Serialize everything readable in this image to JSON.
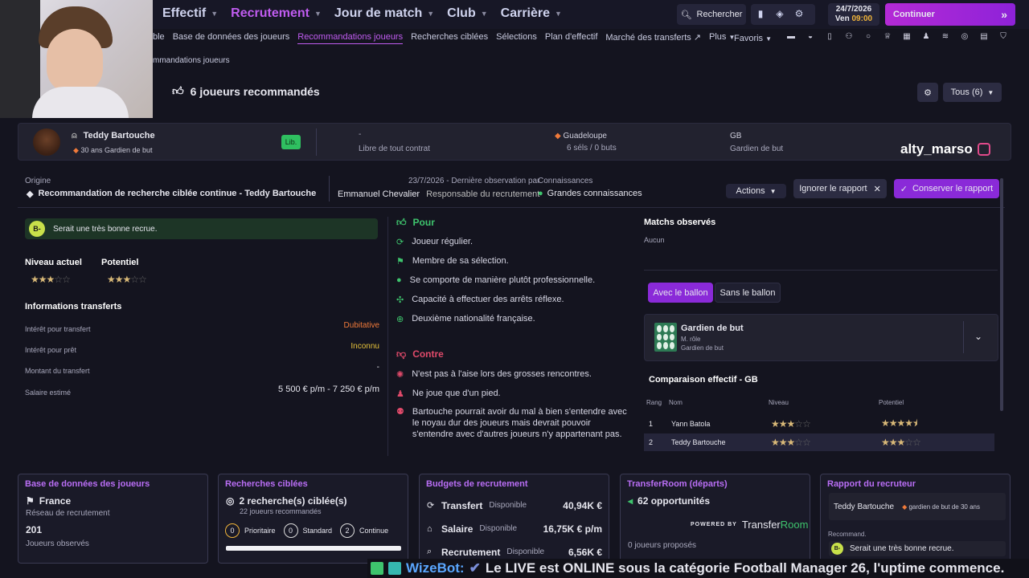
{
  "nav": {
    "main": [
      {
        "label": "Effectif",
        "active": false
      },
      {
        "label": "Recrutement",
        "active": true
      },
      {
        "label": "Jour de match",
        "active": false
      },
      {
        "label": "Club",
        "active": false
      },
      {
        "label": "Carrière",
        "active": false
      }
    ],
    "sub": [
      {
        "label": "ble",
        "active": false
      },
      {
        "label": "Base de données des joueurs",
        "active": false
      },
      {
        "label": "Recommandations joueurs",
        "active": true
      },
      {
        "label": "Recherches ciblées",
        "active": false
      },
      {
        "label": "Sélections",
        "active": false
      },
      {
        "label": "Plan d'effectif",
        "active": false
      },
      {
        "label": "Marché des transferts",
        "active": false
      },
      {
        "label": "Plus",
        "active": false
      }
    ],
    "search_label": "Rechercher",
    "date": "24/7/2026",
    "day": "Ven",
    "time": "09:00",
    "continue_label": "Continuer",
    "favorites_label": "Favoris"
  },
  "breadcrumb": "mmandations joueurs",
  "header": {
    "title": "6 joueurs recommandés",
    "filter_label": "Tous (6)"
  },
  "player": {
    "name": "Teddy Bartouche",
    "age_role": "30 ans  Gardien de but",
    "status_badge": "Lib.",
    "club_dash": "-",
    "contract": "Libre de tout contrat",
    "nation": "Guadeloupe",
    "caps": "6 séls / 0 buts",
    "pos_short": "GB",
    "pos_long": "Gardien de but"
  },
  "watermark": "alty_marso",
  "report": {
    "origin_label": "Origine",
    "origin_text": "Recommandation de recherche ciblée continue - Teddy Bartouche",
    "observed_date": "23/7/2026 - Dernière observation par",
    "scout_name": "Emmanuel Chevalier",
    "scout_role": "Responsable du recrutement",
    "knowledge_label": "Connaissances",
    "knowledge_value": "Grandes connaissances",
    "actions_label": "Actions",
    "ignore_label": "Ignorer le rapport",
    "keep_label": "Conserver le rapport"
  },
  "summary": {
    "grade": "B-",
    "text": "Serait une très bonne recrue."
  },
  "levels": {
    "current_label": "Niveau actuel",
    "potential_label": "Potentiel",
    "current_stars": 3,
    "potential_stars": 3
  },
  "transfer_info": {
    "title": "Informations transferts",
    "rows": [
      {
        "label": "Intérêt pour transfert",
        "value": "Dubitative",
        "color": "#f07a3a"
      },
      {
        "label": "Intérêt pour prêt",
        "value": "Inconnu",
        "color": "#e6c23a"
      },
      {
        "label": "Montant du transfert",
        "value": "-",
        "color": "#d8d8e6"
      },
      {
        "label": "Salaire estimé",
        "value": "5 500 € p/m - 7 250 € p/m",
        "color": "#d8d8e6"
      }
    ]
  },
  "pros": {
    "title": "Pour",
    "items": [
      "Joueur régulier.",
      "Membre de sa sélection.",
      "Se comporte de manière plutôt professionnelle.",
      "Capacité à effectuer des arrêts réflexe.",
      "Deuxième nationalité française."
    ]
  },
  "cons": {
    "title": "Contre",
    "items": [
      "N'est pas à l'aise lors des grosses rencontres.",
      "Ne joue que d'un pied.",
      "Bartouche pourrait avoir du mal à bien s'entendre avec le noyau dur des joueurs mais devrait pouvoir s'entendre avec d'autres joueurs n'y appartenant pas."
    ]
  },
  "matches": {
    "title": "Matchs observés",
    "value": "Aucun"
  },
  "ball_tabs": {
    "with": "Avec le ballon",
    "without": "Sans le ballon"
  },
  "role": {
    "title": "Gardien de but",
    "sub": "M. rôle",
    "pos": "Gardien de but"
  },
  "comparison": {
    "title": "Comparaison effectif - GB",
    "headers": [
      "Rang",
      "Nom",
      "Niveau",
      "Potentiel"
    ],
    "rows": [
      {
        "rank": "1",
        "name": "Yann Batola",
        "level": 3,
        "potential": 4.5
      },
      {
        "rank": "2",
        "name": "Teddy Bartouche",
        "level": 3,
        "potential": 3
      }
    ]
  },
  "cards": {
    "db": {
      "title": "Base de données des joueurs",
      "country": "France",
      "network": "Réseau de recrutement",
      "count": "201",
      "count_label": "Joueurs observés"
    },
    "searches": {
      "title": "Recherches ciblées",
      "main": "2 recherche(s) ciblée(s)",
      "sub": "22 joueurs recommandés",
      "prio_n": "0",
      "prio": "Prioritaire",
      "std_n": "0",
      "std": "Standard",
      "cont_n": "2",
      "cont": "Continue"
    },
    "budgets": {
      "title": "Budgets de recrutement",
      "rows": [
        {
          "label": "Transfert",
          "avail": "Disponible",
          "value": "40,94K €"
        },
        {
          "label": "Salaire",
          "avail": "Disponible",
          "value": "16,75K € p/m"
        },
        {
          "label": "Recrutement",
          "avail": "Disponible",
          "value": "6,56K €"
        }
      ]
    },
    "transferroom": {
      "title": "TransferRoom (départs)",
      "opps": "62 opportunités",
      "powered": "POWERED BY",
      "brand1": "Transfer",
      "brand2": "Room",
      "proposed": "0 joueurs proposés"
    },
    "scout_report": {
      "title": "Rapport du recruteur",
      "player": "Teddy Bartouche",
      "desc": "gardien de but de 30 ans",
      "recomm": "Recommand.",
      "grade": "B-",
      "text": "Serait une très bonne recrue."
    }
  },
  "ticker": {
    "bot": "WizeBot:",
    "text": "Le LIVE est ONLINE sous la catégorie Football Manager 26, l'uptime commence."
  }
}
